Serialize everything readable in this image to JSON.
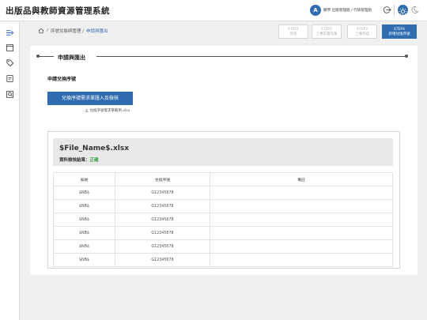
{
  "app": {
    "title": "出版品與教師資源管理系統"
  },
  "user": {
    "initial": "A",
    "info": "數學 出版管理組 / 行銷管理組"
  },
  "breadcrumb": {
    "items": [
      "序號兌換與管理 /",
      "申請與匯出"
    ]
  },
  "steps": [
    {
      "title": "STEP1",
      "label": "充值"
    },
    {
      "title": "STEP2",
      "label": "上傳前置作業"
    },
    {
      "title": "STEP3",
      "label": "上傳完成"
    },
    {
      "title": "STEP4",
      "label": "新增兌換序號"
    }
  ],
  "section": {
    "title": "申請與匯出"
  },
  "apply": {
    "subtitle": "申請兌換序號",
    "import_button": "兌換序號需求單匯入及檢核",
    "download_link": "兌換序號需求單範例.xlsx"
  },
  "result": {
    "file_name": "$File_Name$.xlsx",
    "label": "資料檢核結果：",
    "status": "正確",
    "status_color": "#2e9a3e"
  },
  "table": {
    "columns": [
      "編號",
      "兌換序號",
      "備註"
    ],
    "rows": [
      [
        "$NB$",
        "G12345678",
        ""
      ],
      [
        "$NB$",
        "G12345678",
        ""
      ],
      [
        "$NB$",
        "G12345678",
        ""
      ],
      [
        "$NB$",
        "G12345678",
        ""
      ],
      [
        "$NB$",
        "G12345678",
        ""
      ],
      [
        "$NB$",
        "G12345678",
        ""
      ]
    ]
  },
  "icons": [
    "home-icon",
    "logout-icon",
    "sun-icon",
    "moon-icon",
    "menu-expand-icon",
    "window-icon",
    "tag-icon",
    "document-icon",
    "search-doc-icon",
    "download-icon"
  ],
  "colors": {
    "primary": "#2f6db0",
    "success": "#2e9a3e"
  }
}
